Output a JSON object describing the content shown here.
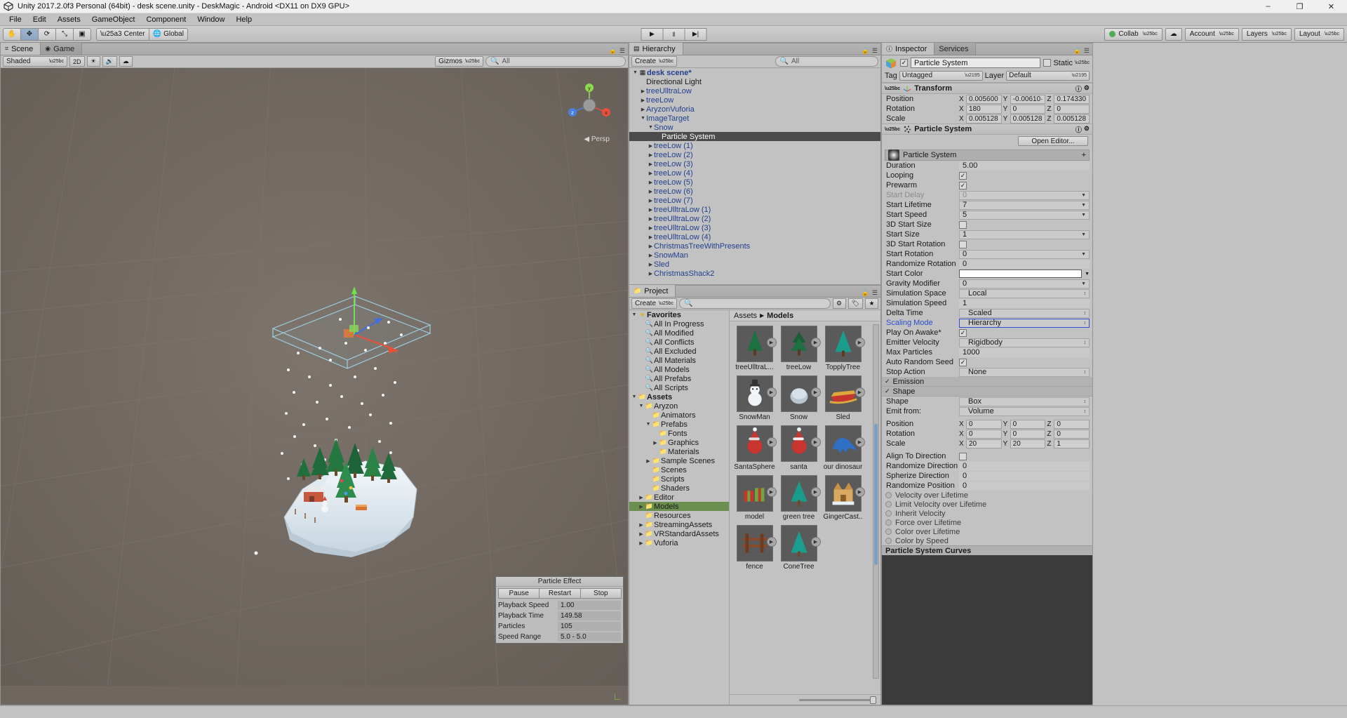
{
  "window": {
    "title": "Unity 2017.2.0f3 Personal (64bit) - desk scene.unity - DeskMagic - Android <DX11 on DX9 GPU>",
    "minimize": "–",
    "maximize": "❐",
    "close": "✕"
  },
  "menu": [
    "File",
    "Edit",
    "Assets",
    "GameObject",
    "Component",
    "Window",
    "Help"
  ],
  "toolbar": {
    "tools": [
      "✋",
      "✥",
      "⟳",
      "⤡",
      "▣"
    ],
    "pivot": "Center",
    "space": "Global",
    "play": "▶",
    "pause": "‖",
    "step": "▶|",
    "collab": "Collab",
    "cloud": "☁",
    "account": "Account",
    "layers": "Layers",
    "layout": "Layout"
  },
  "scene": {
    "tabs": [
      {
        "label": "Scene",
        "icon": "⌗",
        "active": true
      },
      {
        "label": "Game",
        "icon": "◉",
        "active": false
      }
    ],
    "shading": "Shaded",
    "mode2d": "2D",
    "lighting": "☀",
    "audio": "🔊",
    "fx": "☁",
    "gizmos": "Gizmos",
    "search_placeholder": "All",
    "persp_label": "◀ Persp",
    "axes": {
      "x": "x",
      "y": "y",
      "z": "z"
    },
    "particle_effect": {
      "title": "Particle Effect",
      "buttons": [
        "Pause",
        "Restart",
        "Stop"
      ],
      "rows": [
        {
          "label": "Playback Speed",
          "value": "1.00"
        },
        {
          "label": "Playback Time",
          "value": "149.58"
        },
        {
          "label": "Particles",
          "value": "105"
        },
        {
          "label": "Speed Range",
          "value": "5.0 - 5.0"
        }
      ]
    }
  },
  "hierarchy": {
    "tab": "Hierarchy",
    "create": "Create",
    "search_placeholder": "All",
    "items": [
      {
        "label": "desk scene*",
        "depth": 0,
        "tri": "▼",
        "icon": "▦",
        "type": "scene",
        "selected": false
      },
      {
        "label": "Directional Light",
        "depth": 1,
        "tri": "",
        "icon": "",
        "type": "plain",
        "selected": false
      },
      {
        "label": "treeUlltraLow",
        "depth": 1,
        "tri": "▶",
        "icon": "",
        "type": "prefab",
        "selected": false
      },
      {
        "label": "treeLow",
        "depth": 1,
        "tri": "▶",
        "icon": "",
        "type": "prefab",
        "selected": false
      },
      {
        "label": "AryzonVuforia",
        "depth": 1,
        "tri": "▶",
        "icon": "",
        "type": "prefab",
        "selected": false
      },
      {
        "label": "ImageTarget",
        "depth": 1,
        "tri": "▼",
        "icon": "",
        "type": "prefab",
        "selected": false
      },
      {
        "label": "Snow",
        "depth": 2,
        "tri": "▼",
        "icon": "",
        "type": "prefab",
        "selected": false
      },
      {
        "label": "Particle System",
        "depth": 3,
        "tri": "",
        "icon": "",
        "type": "plain",
        "selected": true
      },
      {
        "label": "treeLow (1)",
        "depth": 2,
        "tri": "▶",
        "icon": "",
        "type": "prefab",
        "selected": false
      },
      {
        "label": "treeLow (2)",
        "depth": 2,
        "tri": "▶",
        "icon": "",
        "type": "prefab",
        "selected": false
      },
      {
        "label": "treeLow (3)",
        "depth": 2,
        "tri": "▶",
        "icon": "",
        "type": "prefab",
        "selected": false
      },
      {
        "label": "treeLow (4)",
        "depth": 2,
        "tri": "▶",
        "icon": "",
        "type": "prefab",
        "selected": false
      },
      {
        "label": "treeLow (5)",
        "depth": 2,
        "tri": "▶",
        "icon": "",
        "type": "prefab",
        "selected": false
      },
      {
        "label": "treeLow (6)",
        "depth": 2,
        "tri": "▶",
        "icon": "",
        "type": "prefab",
        "selected": false
      },
      {
        "label": "treeLow (7)",
        "depth": 2,
        "tri": "▶",
        "icon": "",
        "type": "prefab",
        "selected": false
      },
      {
        "label": "treeUlltraLow (1)",
        "depth": 2,
        "tri": "▶",
        "icon": "",
        "type": "prefab",
        "selected": false
      },
      {
        "label": "treeUlltraLow (2)",
        "depth": 2,
        "tri": "▶",
        "icon": "",
        "type": "prefab",
        "selected": false
      },
      {
        "label": "treeUlltraLow (3)",
        "depth": 2,
        "tri": "▶",
        "icon": "",
        "type": "prefab",
        "selected": false
      },
      {
        "label": "treeUlltraLow (4)",
        "depth": 2,
        "tri": "▶",
        "icon": "",
        "type": "prefab",
        "selected": false
      },
      {
        "label": "ChristmasTreeWithPresents",
        "depth": 2,
        "tri": "▶",
        "icon": "",
        "type": "prefab",
        "selected": false
      },
      {
        "label": "SnowMan",
        "depth": 2,
        "tri": "▶",
        "icon": "",
        "type": "prefab",
        "selected": false
      },
      {
        "label": "Sled",
        "depth": 2,
        "tri": "▶",
        "icon": "",
        "type": "prefab",
        "selected": false
      },
      {
        "label": "ChristmasShack2",
        "depth": 2,
        "tri": "▶",
        "icon": "",
        "type": "prefab",
        "selected": false
      }
    ]
  },
  "project": {
    "tab": "Project",
    "create": "Create",
    "search_placeholder": "",
    "breadcrumb": {
      "root": "Assets",
      "sep": "▶",
      "current": "Models"
    },
    "tree": [
      {
        "label": "Favorites",
        "depth": 0,
        "tri": "▼",
        "icon": "★",
        "sel": false
      },
      {
        "label": "All In Progress",
        "depth": 1,
        "tri": "",
        "icon": "🔍",
        "sel": false
      },
      {
        "label": "All Modified",
        "depth": 1,
        "tri": "",
        "icon": "🔍",
        "sel": false
      },
      {
        "label": "All Conflicts",
        "depth": 1,
        "tri": "",
        "icon": "🔍",
        "sel": false
      },
      {
        "label": "All Excluded",
        "depth": 1,
        "tri": "",
        "icon": "🔍",
        "sel": false
      },
      {
        "label": "All Materials",
        "depth": 1,
        "tri": "",
        "icon": "🔍",
        "sel": false
      },
      {
        "label": "All Models",
        "depth": 1,
        "tri": "",
        "icon": "🔍",
        "sel": false
      },
      {
        "label": "All Prefabs",
        "depth": 1,
        "tri": "",
        "icon": "🔍",
        "sel": false
      },
      {
        "label": "All Scripts",
        "depth": 1,
        "tri": "",
        "icon": "🔍",
        "sel": false
      },
      {
        "label": "Assets",
        "depth": 0,
        "tri": "▼",
        "icon": "📁",
        "sel": false
      },
      {
        "label": "Aryzon",
        "depth": 1,
        "tri": "▼",
        "icon": "📁",
        "sel": false
      },
      {
        "label": "Animators",
        "depth": 2,
        "tri": "",
        "icon": "📁",
        "sel": false
      },
      {
        "label": "Prefabs",
        "depth": 2,
        "tri": "▼",
        "icon": "📁",
        "sel": false
      },
      {
        "label": "Fonts",
        "depth": 3,
        "tri": "",
        "icon": "📁",
        "sel": false
      },
      {
        "label": "Graphics",
        "depth": 3,
        "tri": "▶",
        "icon": "📁",
        "sel": false
      },
      {
        "label": "Materials",
        "depth": 3,
        "tri": "",
        "icon": "📁",
        "sel": false
      },
      {
        "label": "Sample Scenes",
        "depth": 2,
        "tri": "▶",
        "icon": "📁",
        "sel": false
      },
      {
        "label": "Scenes",
        "depth": 2,
        "tri": "",
        "icon": "📁",
        "sel": false
      },
      {
        "label": "Scripts",
        "depth": 2,
        "tri": "",
        "icon": "📁",
        "sel": false
      },
      {
        "label": "Shaders",
        "depth": 2,
        "tri": "",
        "icon": "📁",
        "sel": false
      },
      {
        "label": "Editor",
        "depth": 1,
        "tri": "▶",
        "icon": "📁",
        "sel": false
      },
      {
        "label": "Models",
        "depth": 1,
        "tri": "▶",
        "icon": "📁",
        "sel": true
      },
      {
        "label": "Resources",
        "depth": 1,
        "tri": "",
        "icon": "📁",
        "sel": false
      },
      {
        "label": "StreamingAssets",
        "depth": 1,
        "tri": "▶",
        "icon": "📁",
        "sel": false
      },
      {
        "label": "VRStandardAssets",
        "depth": 1,
        "tri": "▶",
        "icon": "📁",
        "sel": false
      },
      {
        "label": "Vuforia",
        "depth": 1,
        "tri": "▶",
        "icon": "📁",
        "sel": false
      }
    ],
    "assets": [
      {
        "name": "ConeTree",
        "kind": "conetree"
      },
      {
        "name": "fence",
        "kind": "fence"
      },
      {
        "name": "GingerCast..",
        "kind": "castle"
      },
      {
        "name": "green tree",
        "kind": "greentree"
      },
      {
        "name": "model",
        "kind": "presents"
      },
      {
        "name": "our dinosaur",
        "kind": "dino"
      },
      {
        "name": "santa",
        "kind": "santa"
      },
      {
        "name": "SantaSphere",
        "kind": "santasphere"
      },
      {
        "name": "Sled",
        "kind": "sled"
      },
      {
        "name": "Snow",
        "kind": "snow"
      },
      {
        "name": "SnowMan",
        "kind": "snowman"
      },
      {
        "name": "TopplyTree",
        "kind": "topplytree"
      },
      {
        "name": "treeLow",
        "kind": "treelow"
      },
      {
        "name": "treeUlltraL...",
        "kind": "treeultralow"
      }
    ]
  },
  "inspector": {
    "tabs": [
      {
        "label": "Inspector",
        "icon": "ⓘ",
        "active": true
      },
      {
        "label": "Services",
        "icon": "",
        "active": false
      }
    ],
    "object_name": "Particle System",
    "enabled": true,
    "static_label": "Static",
    "static_checked": false,
    "tag_label": "Tag",
    "tag_value": "Untagged",
    "layer_label": "Layer",
    "layer_value": "Default",
    "transform": {
      "title": "Transform",
      "rows": [
        {
          "label": "Position",
          "x": "0.005600",
          "y": "-0.00610·",
          "z": "0.174330"
        },
        {
          "label": "Rotation",
          "x": "180",
          "y": "0",
          "z": "0"
        },
        {
          "label": "Scale",
          "x": "0.005128",
          "y": "0.005128",
          "z": "0.005128"
        }
      ]
    },
    "particle_system": {
      "title": "Particle System",
      "open_editor": "Open Editor...",
      "module_name": "Particle System",
      "properties": [
        {
          "label": "Duration",
          "value": "5.00",
          "type": "text"
        },
        {
          "label": "Looping",
          "value": "",
          "type": "check",
          "checked": true
        },
        {
          "label": "Prewarm",
          "value": "",
          "type": "check",
          "checked": true
        },
        {
          "label": "Start Delay",
          "value": "0",
          "type": "dropdown-dim"
        },
        {
          "label": "Start Lifetime",
          "value": "7",
          "type": "dropdown"
        },
        {
          "label": "Start Speed",
          "value": "5",
          "type": "dropdown"
        },
        {
          "label": "3D Start Size",
          "value": "",
          "type": "check",
          "checked": false
        },
        {
          "label": "Start Size",
          "value": "1",
          "type": "dropdown"
        },
        {
          "label": "3D Start Rotation",
          "value": "",
          "type": "check",
          "checked": false
        },
        {
          "label": "Start Rotation",
          "value": "0",
          "type": "dropdown"
        },
        {
          "label": "Randomize Rotation",
          "value": "0",
          "type": "text"
        },
        {
          "label": "Start Color",
          "value": "",
          "type": "color",
          "color": "#ffffff"
        },
        {
          "label": "Gravity Modifier",
          "value": "0",
          "type": "dropdown"
        },
        {
          "label": "Simulation Space",
          "value": "Local",
          "type": "select"
        },
        {
          "label": "Simulation Speed",
          "value": "1",
          "type": "text"
        },
        {
          "label": "Delta Time",
          "value": "Scaled",
          "type": "select"
        },
        {
          "label": "Scaling Mode",
          "value": "Hierarchy",
          "type": "select-hl"
        },
        {
          "label": "Play On Awake*",
          "value": "",
          "type": "check",
          "checked": true
        },
        {
          "label": "Emitter Velocity",
          "value": "Rigidbody",
          "type": "select"
        },
        {
          "label": "Max Particles",
          "value": "1000",
          "type": "text"
        },
        {
          "label": "Auto Random Seed",
          "value": "",
          "type": "check",
          "checked": true
        },
        {
          "label": "Stop Action",
          "value": "None",
          "type": "select"
        }
      ],
      "emission_header": "Emission",
      "shape_header": "Shape",
      "shape_props": [
        {
          "label": "Shape",
          "value": "Box",
          "type": "select"
        },
        {
          "label": "Emit from:",
          "value": "Volume",
          "type": "select"
        }
      ],
      "shape_vectors": [
        {
          "label": "Position",
          "x": "0",
          "y": "0",
          "z": "0"
        },
        {
          "label": "Rotation",
          "x": "0",
          "y": "0",
          "z": "0"
        },
        {
          "label": "Scale",
          "x": "20",
          "y": "20",
          "z": "1"
        }
      ],
      "shape_extra": [
        {
          "label": "Align To Direction",
          "value": "",
          "type": "check",
          "checked": false
        },
        {
          "label": "Randomize Direction",
          "value": "0",
          "type": "text"
        },
        {
          "label": "Spherize Direction",
          "value": "0",
          "type": "text"
        },
        {
          "label": "Randomize Position",
          "value": "0",
          "type": "text"
        }
      ],
      "modules": [
        "Velocity over Lifetime",
        "Limit Velocity over Lifetime",
        "Inherit Velocity",
        "Force over Lifetime",
        "Color over Lifetime",
        "Color by Speed"
      ],
      "curves_title": "Particle System Curves"
    }
  }
}
